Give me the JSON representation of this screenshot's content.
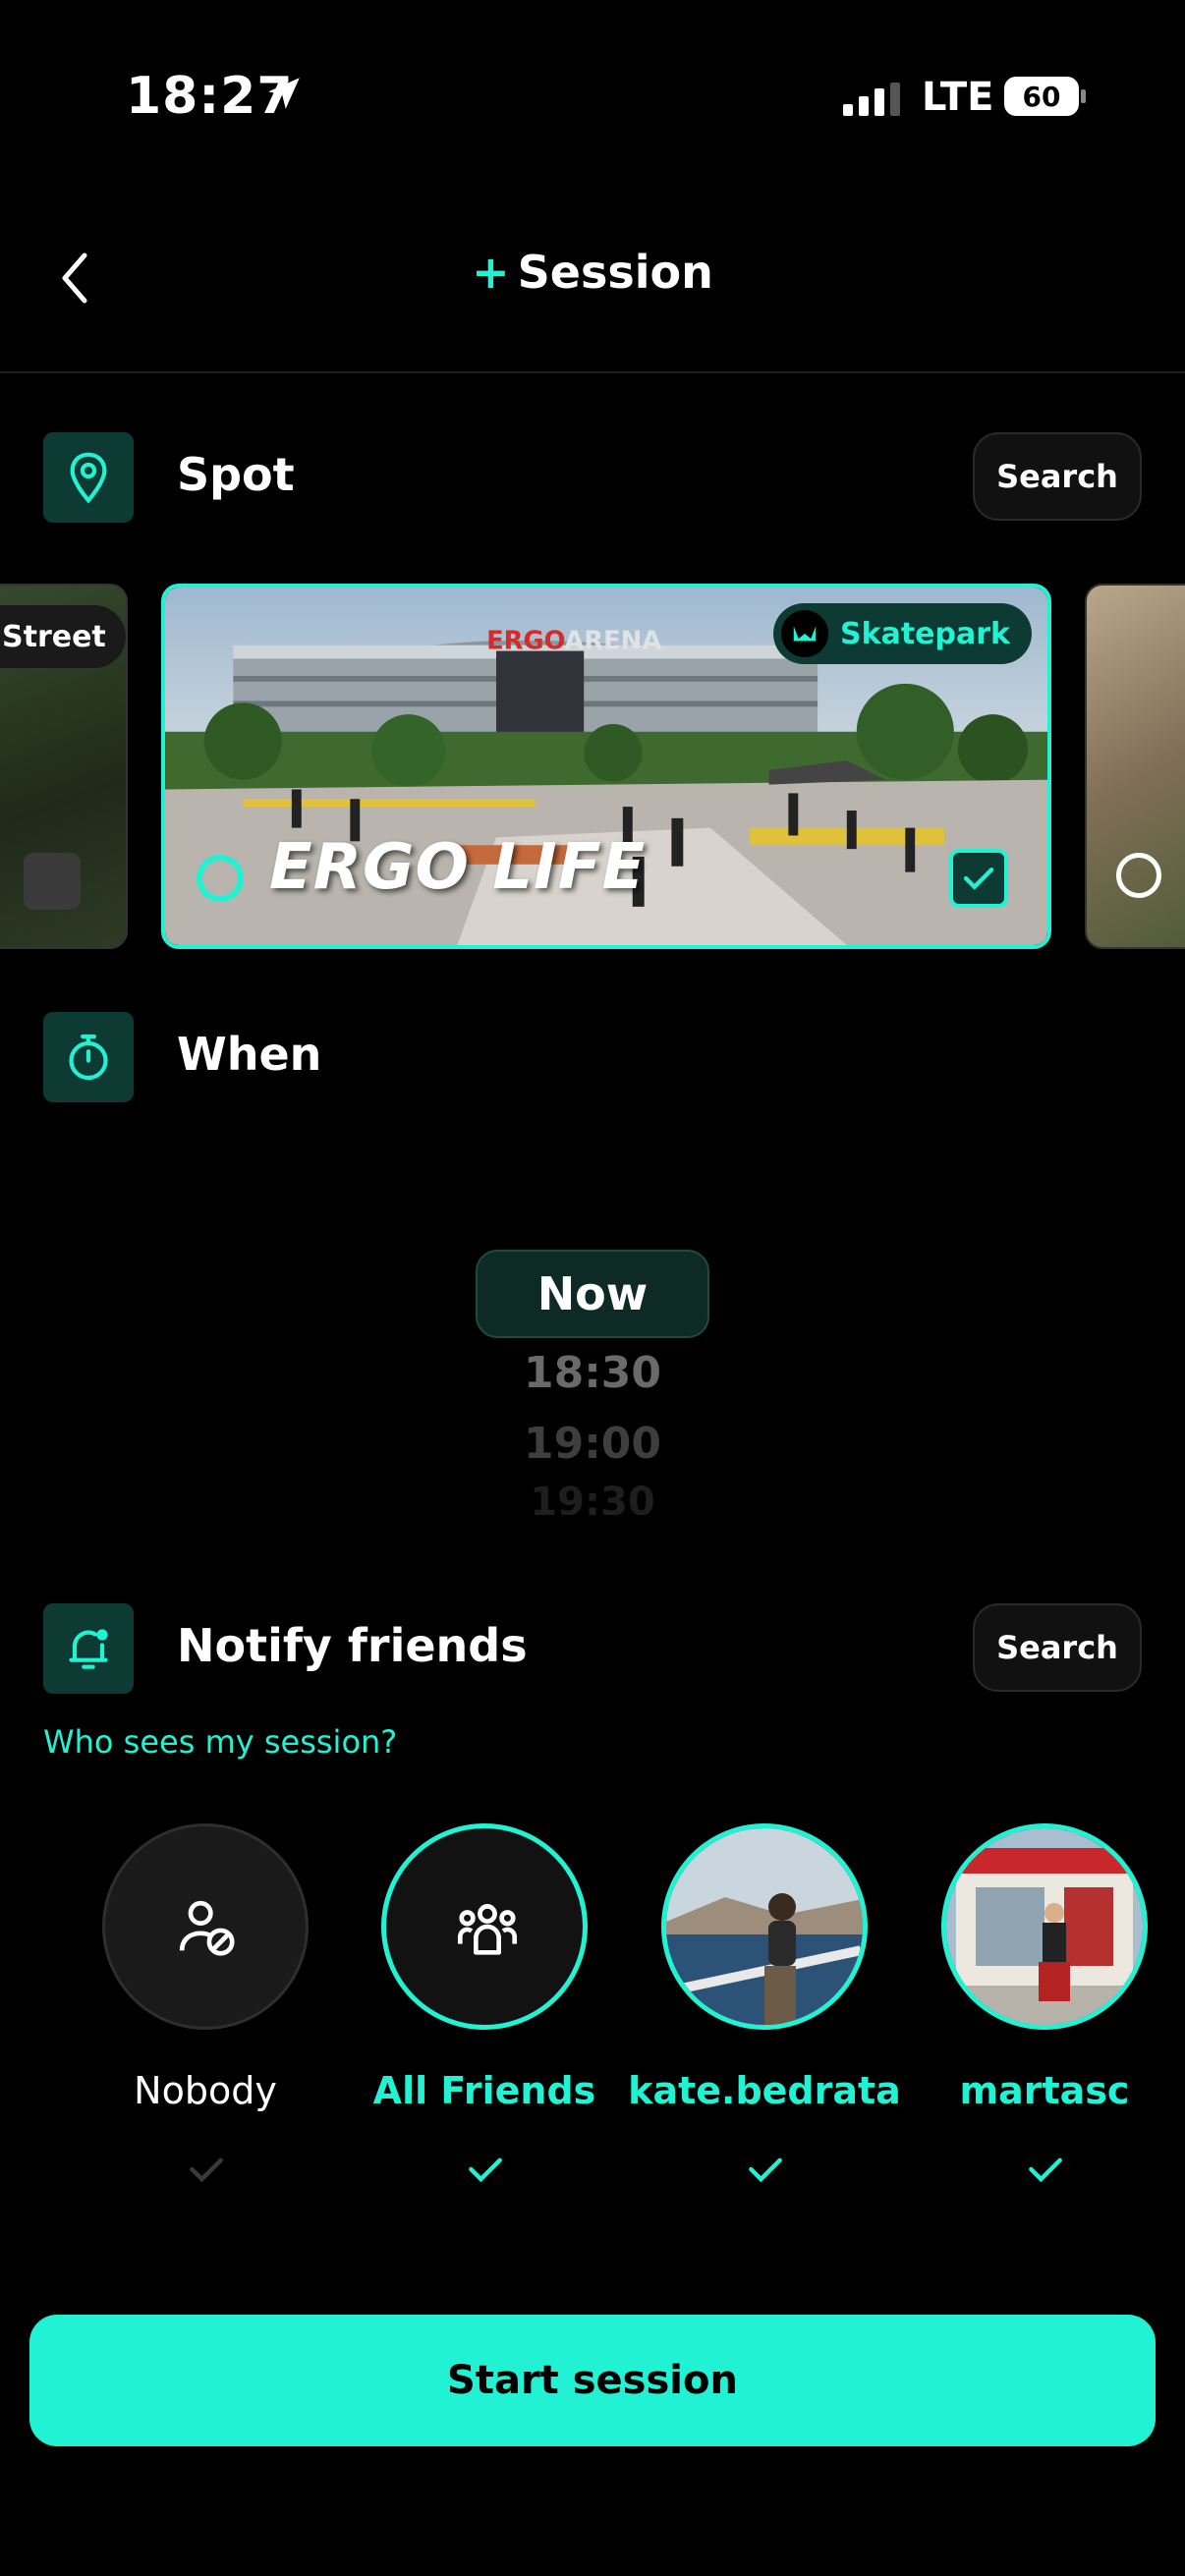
{
  "status": {
    "time": "18:27",
    "network": "LTE",
    "battery": "60"
  },
  "header": {
    "plus": "+",
    "title": "Session"
  },
  "spot": {
    "title": "Spot",
    "search_label": "Search",
    "cards": {
      "left": {
        "badge": "Street"
      },
      "main": {
        "badge": "Skatepark",
        "name": "ERGO LIFE",
        "selected": true
      }
    }
  },
  "when": {
    "title": "When",
    "options": [
      "Now",
      "18:30",
      "19:00",
      "19:30"
    ],
    "selected": "Now"
  },
  "notify": {
    "title": "Notify friends",
    "search_label": "Search",
    "who_link": "Who sees my session?",
    "friends": [
      {
        "name": "Nobody",
        "selected": false
      },
      {
        "name": "All Friends",
        "selected": true
      },
      {
        "name": "kate.bedrata",
        "selected": true
      },
      {
        "name": "martasc",
        "selected": true
      }
    ]
  },
  "actions": {
    "start_label": "Start session"
  },
  "colors": {
    "accent": "#22f2d4",
    "background": "#000000",
    "icon_bg": "#0d3b33"
  }
}
